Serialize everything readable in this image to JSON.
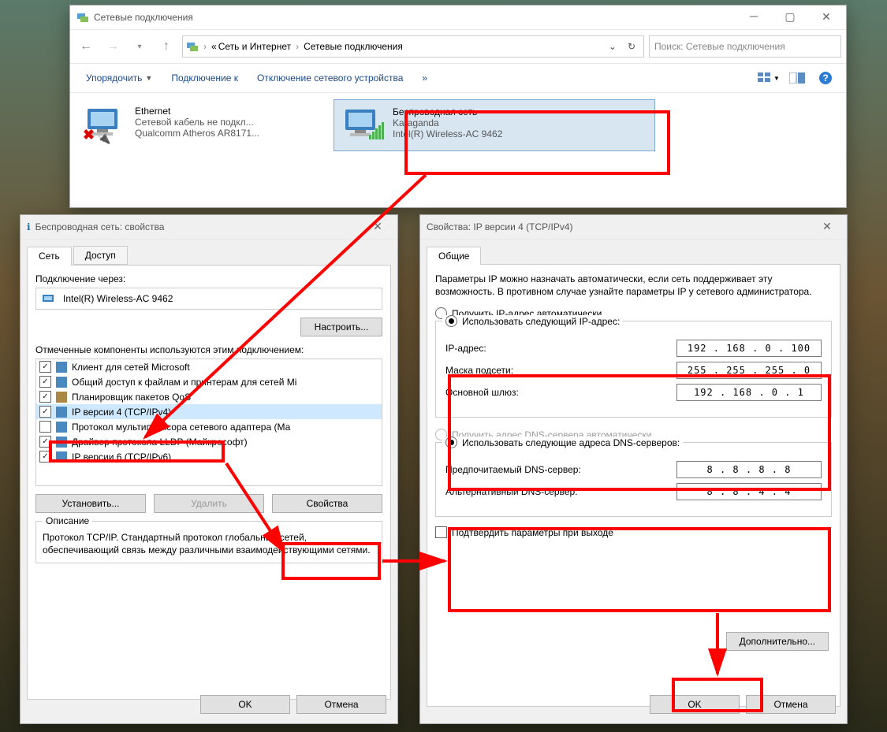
{
  "explorer": {
    "title": "Сетевые подключения",
    "breadcrumb": {
      "pre": "«",
      "p1": "Сеть и Интернет",
      "p2": "Сетевые подключения"
    },
    "search_placeholder": "Поиск: Сетевые подключения",
    "toolbar": {
      "organize": "Упорядочить",
      "connect": "Подключение к",
      "disable": "Отключение сетевого устройства",
      "more": "»"
    },
    "ethernet": {
      "name": "Ethernet",
      "status": "Сетевой кабель не подкл...",
      "device": "Qualcomm Atheros AR8171..."
    },
    "wifi": {
      "name": "Беспроводная сеть",
      "status": "Karaganda",
      "device": "Intel(R) Wireless-AC 9462"
    }
  },
  "props": {
    "title": "Беспроводная сеть: свойства",
    "tab_net": "Сеть",
    "tab_access": "Доступ",
    "conn_via": "Подключение через:",
    "adapter": "Intel(R) Wireless-AC 9462",
    "configure": "Настроить...",
    "components_label": "Отмеченные компоненты используются этим подключением:",
    "items": [
      "Клиент для сетей Microsoft",
      "Общий доступ к файлам и принтерам для сетей Mi",
      "Планировщик пакетов QoS",
      "IP версии 4 (TCP/IPv4)",
      "Протокол мультиплексора сетевого адаптера (Ма",
      "Драйвер протокола LLDP (Майкрософт)",
      "IP версии 6 (TCP/IPv6)"
    ],
    "item4_unchecked": true,
    "install": "Установить...",
    "remove": "Удалить",
    "properties": "Свойства",
    "desc_title": "Описание",
    "desc": "Протокол TCP/IP. Стандартный протокол глобальных сетей, обеспечивающий связь между различными взаимодействующими сетями.",
    "ok": "OK",
    "cancel": "Отмена"
  },
  "ipv4": {
    "title": "Свойства: IP версии 4 (TCP/IPv4)",
    "tab": "Общие",
    "para": "Параметры IP можно назначать автоматически, если сеть поддерживает эту возможность. В противном случае узнайте параметры IP у сетевого администратора.",
    "auto_ip": "Получить IP-адрес автоматически",
    "use_ip": "Использовать следующий IP-адрес:",
    "ip_label": "IP-адрес:",
    "ip": "192 . 168 .  0  . 100",
    "mask_label": "Маска подсети:",
    "mask": "255 . 255 . 255 .  0",
    "gw_label": "Основной шлюз:",
    "gw": "192 . 168 .  0  .  1",
    "auto_dns": "Получить адрес DNS-сервера автоматически",
    "use_dns": "Использовать следующие адреса DNS-серверов:",
    "dns1_label": "Предпочитаемый DNS-сервер:",
    "dns1": "8  .  8  .  8  .  8",
    "dns2_label": "Альтернативный DNS-сервер:",
    "dns2": "8  .  8  .  4  .  4",
    "confirm": "Подтвердить параметры при выходе",
    "advanced": "Дополнительно...",
    "ok": "OK",
    "cancel": "Отмена"
  }
}
